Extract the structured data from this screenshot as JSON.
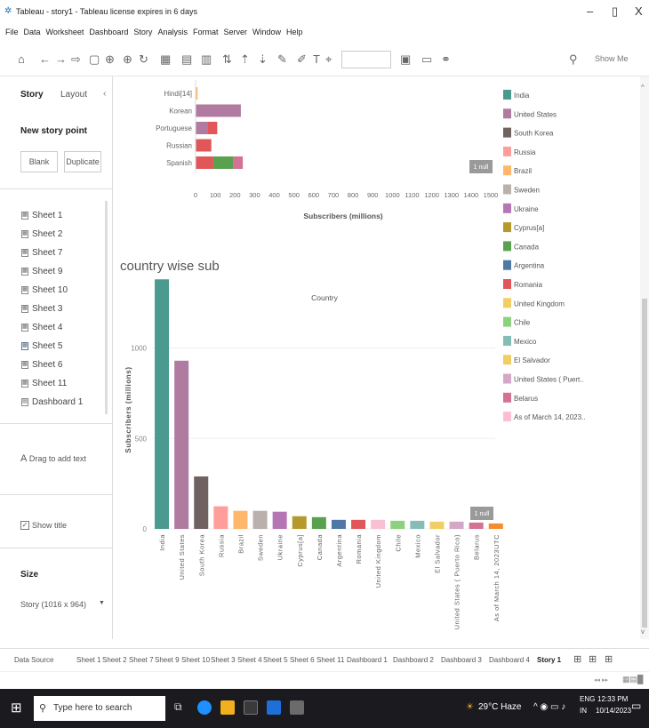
{
  "window": {
    "title": "Tableau - story1 - Tableau license expires in 6 days",
    "minimize": "–",
    "maximize": "▯",
    "close": "X"
  },
  "menu": [
    "File",
    "Data",
    "Worksheet",
    "Dashboard",
    "Story",
    "Analysis",
    "Format",
    "Server",
    "Window",
    "Help"
  ],
  "toolbar": {
    "show_me": "Show Me"
  },
  "sidebar": {
    "tab_story": "Story",
    "tab_layout": "Layout",
    "collapse": "‹",
    "new_story_point": "New story point",
    "blank": "Blank",
    "duplicate": "Duplicate",
    "sheets": [
      "Sheet 1",
      "Sheet 2",
      "Sheet 7",
      "Sheet 9",
      "Sheet 10",
      "Sheet 3",
      "Sheet 4",
      "Sheet 5",
      "Sheet 6",
      "Sheet 11",
      "Dashboard 1"
    ],
    "drag_to_add_text": "Drag to add text",
    "show_title": "Show title",
    "size_heading": "Size",
    "size_value": "Story (1016 x 964)"
  },
  "legend": {
    "items": [
      {
        "label": "India",
        "color": "#4a9a8f"
      },
      {
        "label": "United States",
        "color": "#b07aa1"
      },
      {
        "label": "South Korea",
        "color": "#6f6261"
      },
      {
        "label": "Russia",
        "color": "#ff9d9a"
      },
      {
        "label": "Brazil",
        "color": "#ffb76b"
      },
      {
        "label": "Sweden",
        "color": "#bab0ac"
      },
      {
        "label": "Ukraine",
        "color": "#b576b6"
      },
      {
        "label": "Cyprus[a]",
        "color": "#b6992d"
      },
      {
        "label": "Canada",
        "color": "#59a14f"
      },
      {
        "label": "Argentina",
        "color": "#4e79a7"
      },
      {
        "label": "Romania",
        "color": "#e15759"
      },
      {
        "label": "United Kingdom",
        "color": "#f1ce63"
      },
      {
        "label": "Chile",
        "color": "#8cd17d"
      },
      {
        "label": "Mexico",
        "color": "#86bcb6"
      },
      {
        "label": "El Salvador",
        "color": "#f1ce63"
      },
      {
        "label": "United States ( Puert..",
        "color": "#d4a6c8"
      },
      {
        "label": "Belarus",
        "color": "#d37295"
      },
      {
        "label": "As of March 14, 2023..",
        "color": "#fabfd2"
      }
    ]
  },
  "chart_data": [
    {
      "type": "bar",
      "orientation": "horizontal",
      "stacked": true,
      "categories": [
        "Hindi[14]",
        "Korean",
        "Portuguese",
        "Russian",
        "Spanish"
      ],
      "series": [
        {
          "name": "India",
          "color": "#ffb76b",
          "values": [
            10,
            0,
            0,
            0,
            0
          ]
        },
        {
          "name": "United States",
          "color": "#b07aa1",
          "values": [
            0,
            230,
            60,
            0,
            0
          ]
        },
        {
          "name": "Russia",
          "color": "#e15759",
          "values": [
            0,
            0,
            50,
            80,
            90
          ]
        },
        {
          "name": "Canada",
          "color": "#59a14f",
          "values": [
            0,
            0,
            0,
            0,
            100
          ]
        },
        {
          "name": "Ukraine",
          "color": "#d37295",
          "values": [
            0,
            0,
            0,
            0,
            50
          ]
        }
      ],
      "xlabel": "Subscribers (millions)",
      "xlim": [
        0,
        1500
      ],
      "xticks": [
        0,
        100,
        200,
        300,
        400,
        500,
        600,
        700,
        800,
        900,
        1000,
        1100,
        1200,
        1300,
        1400,
        1500
      ],
      "null_badge": "1 null"
    },
    {
      "type": "bar",
      "title": "country wise sub",
      "header": "Country",
      "categories": [
        "India",
        "United States",
        "South Korea",
        "Russia",
        "Brazil",
        "Sweden",
        "Ukraine",
        "Cyprus[a]",
        "Canada",
        "Argentina",
        "Romania",
        "United Kingdom",
        "Chile",
        "Mexico",
        "El Salvador",
        "United States ( Puerto Rico)",
        "Belarus",
        "As of March 14, 2023UTC"
      ],
      "values": [
        1380,
        930,
        290,
        125,
        100,
        100,
        95,
        70,
        65,
        50,
        50,
        50,
        45,
        45,
        40,
        40,
        35,
        30
      ],
      "colors": [
        "#4a9a8f",
        "#b07aa1",
        "#6f6261",
        "#ff9d9a",
        "#ffb76b",
        "#bab0ac",
        "#b576b6",
        "#b6992d",
        "#59a14f",
        "#4e79a7",
        "#e15759",
        "#fabfd2",
        "#8cd17d",
        "#86bcb6",
        "#f1ce63",
        "#d4a6c8",
        "#d37295",
        "#f28e2b"
      ],
      "ylabel": "Subscribers (millions)",
      "ylim": [
        0,
        1450
      ],
      "yticks": [
        0,
        500,
        1000
      ],
      "null_badge": "1 null"
    }
  ],
  "sheet_tabs": [
    "Data Source",
    "Sheet 1",
    "Sheet 2",
    "Sheet 7",
    "Sheet 9",
    "Sheet 10",
    "Sheet 3",
    "Sheet 4",
    "Sheet 5",
    "Sheet 6",
    "Sheet 11",
    "Dashboard 1",
    "Dashboard 2",
    "Dashboard 3",
    "Dashboard 4",
    "Story 1"
  ],
  "taskbar": {
    "search_placeholder": "Type here to search",
    "weather": "29°C Haze",
    "lang": "ENG",
    "region": "IN",
    "time": "12:33 PM",
    "date": "10/14/2023"
  }
}
